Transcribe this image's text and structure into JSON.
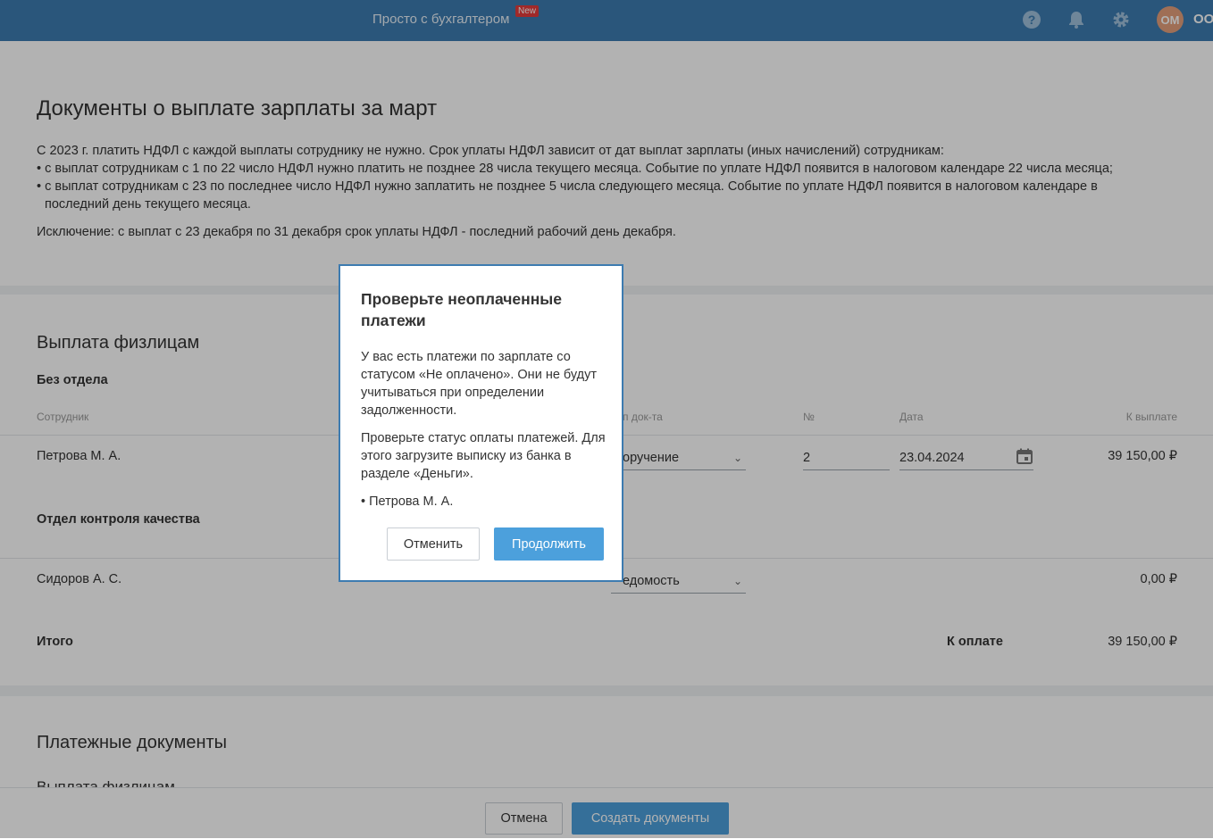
{
  "topbar": {
    "promo_text": "Просто с бухгалтером",
    "promo_badge": "New",
    "avatar_initials": "ОМ",
    "org_name": "ООО",
    "accent_color": "#3d7bb0"
  },
  "page": {
    "title": "Документы о выплате зарплаты за март",
    "info_line1": "С 2023 г. платить НДФЛ с каждой выплаты сотруднику не нужно. Срок уплаты НДФЛ зависит от дат выплат зарплаты (иных начислений) сотрудникам:",
    "info_line2": "• с выплат сотрудникам с 1 по 22 число НДФЛ нужно платить не позднее 28 числа текущего месяца. Событие по уплате НДФЛ появится в налоговом календаре 22 числа месяца;",
    "info_line3a": "• с выплат сотрудникам с 23 по последнее число НДФЛ нужно заплатить не позднее 5 числа следующего месяца. Событие по уплате НДФЛ появится в налоговом календаре в",
    "info_line3b": "последний день текущего месяца.",
    "exception": "Исключение: с выплат с 23 декабря по 31 декабря срок уплаты НДФЛ - последний рабочий день декабря."
  },
  "payouts": {
    "section_title": "Выплата физлицам",
    "columns": {
      "employee": "Сотрудник",
      "doc_type": "п док-та",
      "number": "№",
      "date": "Дата",
      "to_pay": "К выплате"
    },
    "groups": [
      {
        "name": "Без отдела",
        "rows": [
          {
            "employee": "Петрова М. А.",
            "doc_type": "оручение",
            "number": "2",
            "date": "23.04.2024",
            "amount": "39 150,00 ₽"
          }
        ]
      },
      {
        "name": "Отдел контроля качества",
        "rows": [
          {
            "employee": "Сидоров А. С.",
            "doc_type": "едомость",
            "number": "",
            "date": "",
            "amount": "0,00 ₽"
          }
        ]
      }
    ],
    "total_label": "Итого",
    "to_pay_label": "К оплате",
    "total_amount": "39 150,00 ₽"
  },
  "payment_docs": {
    "section_title": "Платежные документы",
    "subsection": "Выплата физлицам"
  },
  "footer": {
    "cancel_label": "Отмена",
    "create_label": "Создать документы"
  },
  "modal": {
    "title": "Проверьте неоплаченные платежи",
    "paragraph1": "У вас есть платежи по зарплате со статусом «Не оплачено». Они не будут учитываться при определении задолженности.",
    "paragraph2": "Проверьте статус оплаты платежей. Для этого загрузите выписку из банка в разделе «Деньги».",
    "item": "• Петрова М. А.",
    "cancel_label": "Отменить",
    "continue_label": "Продолжить"
  }
}
